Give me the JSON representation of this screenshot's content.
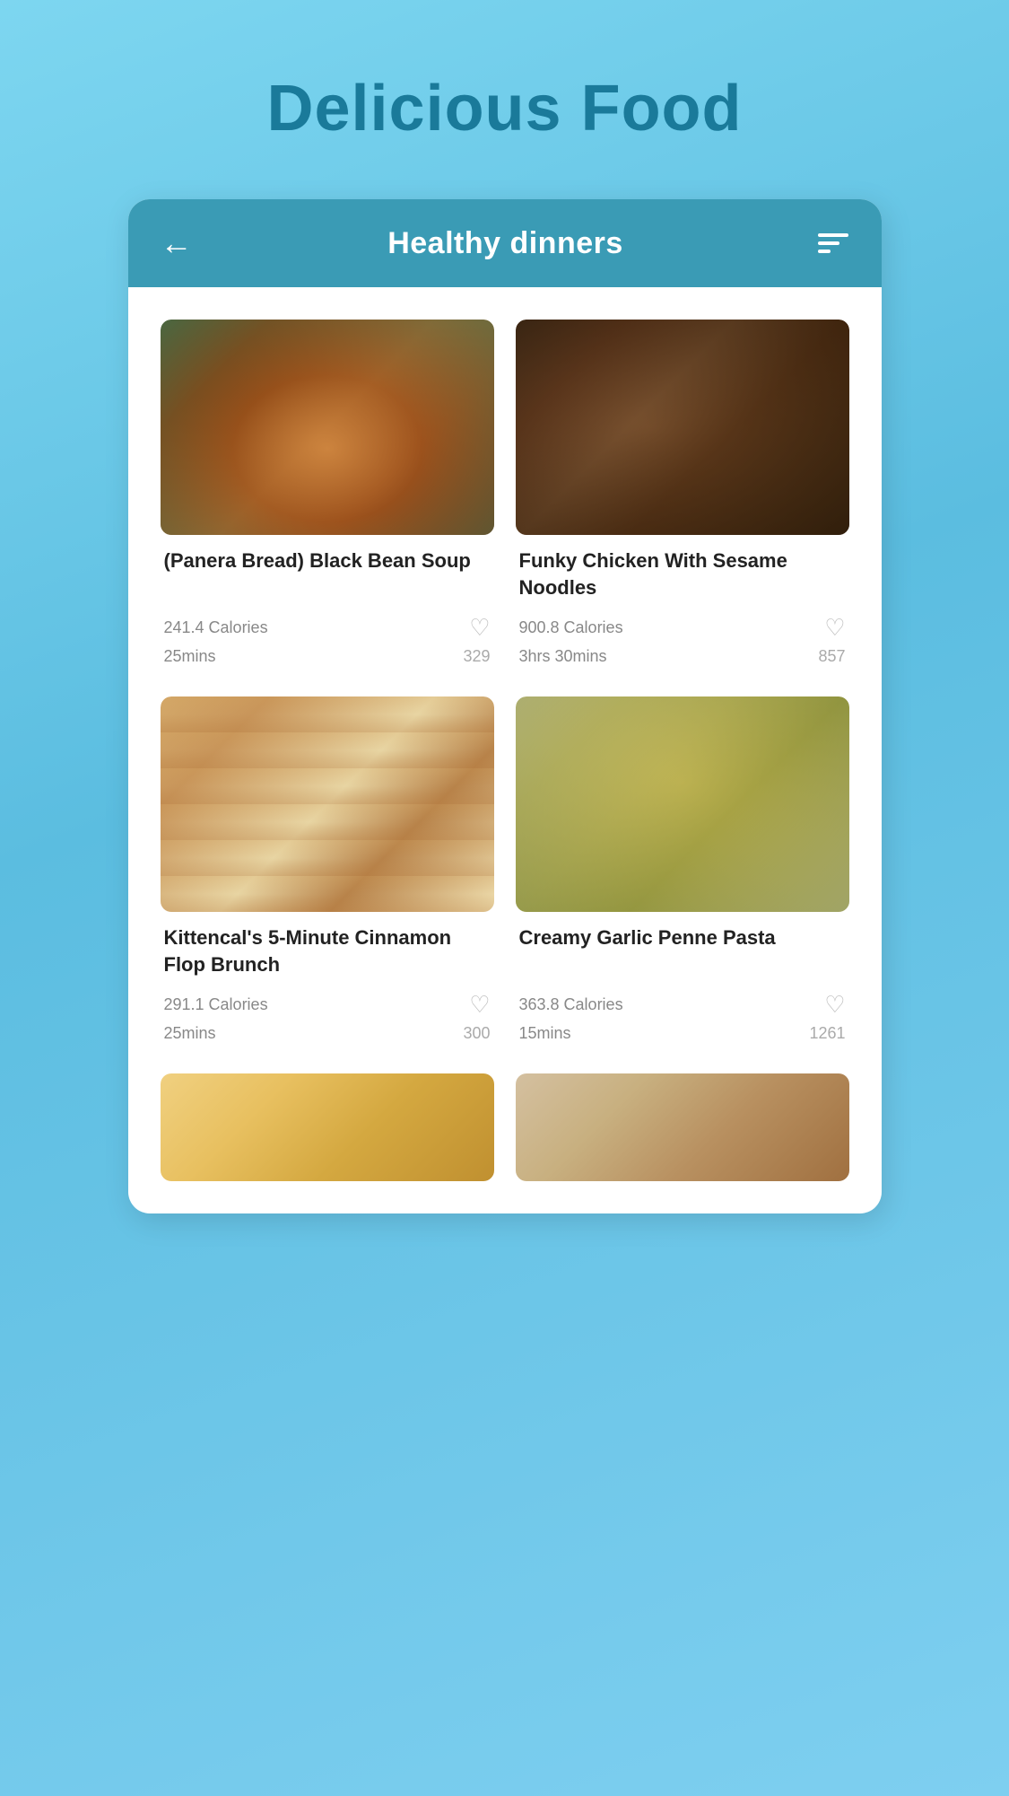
{
  "page": {
    "title": "Delicious Food",
    "background_color": "#6dcbea"
  },
  "header": {
    "back_arrow": "←",
    "title": "Healthy dinners",
    "filter_label": "filter"
  },
  "recipes": [
    {
      "id": "recipe-1",
      "name": "(Panera Bread) Black Bean Soup",
      "calories": "241.4 Calories",
      "time": "25mins",
      "likes": "329",
      "img_class": "img-soup"
    },
    {
      "id": "recipe-2",
      "name": "Funky Chicken With Sesame Noodles",
      "calories": "900.8 Calories",
      "time": "3hrs 30mins",
      "likes": "857",
      "img_class": "img-chicken"
    },
    {
      "id": "recipe-3",
      "name": "Kittencal's 5-Minute Cinnamon Flop Brunch",
      "calories": "291.1 Calories",
      "time": "25mins",
      "likes": "300",
      "img_class": "img-cinnamon"
    },
    {
      "id": "recipe-4",
      "name": "Creamy Garlic Penne Pasta",
      "calories": "363.8 Calories",
      "time": "15mins",
      "likes": "1261",
      "img_class": "img-pasta"
    }
  ],
  "partial_recipes": [
    {
      "id": "partial-1",
      "img_class": "img-bottom-left"
    },
    {
      "id": "partial-2",
      "img_class": "img-bottom-right"
    }
  ]
}
